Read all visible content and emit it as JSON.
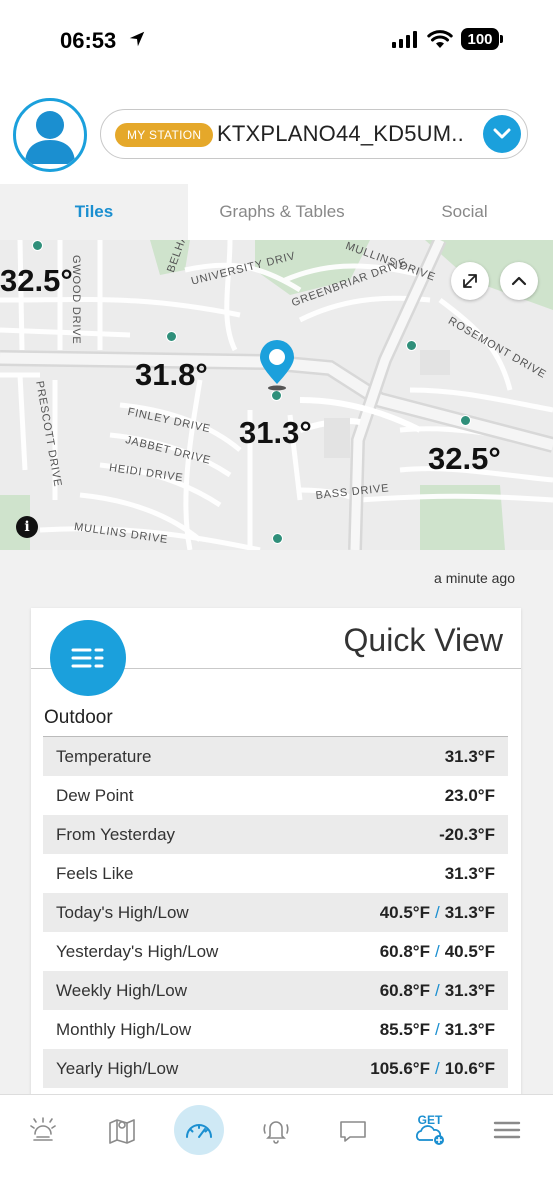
{
  "status_bar": {
    "time": "06:53",
    "battery": "100"
  },
  "header": {
    "station_badge": "MY STATION",
    "station_name": "KTXPLANO44_KD5UM.."
  },
  "tabs": [
    {
      "label": "Tiles",
      "active": true
    },
    {
      "label": "Graphs & Tables",
      "active": false
    },
    {
      "label": "Social",
      "active": false
    }
  ],
  "map": {
    "temps": [
      "32.5°",
      "31.8°",
      "31.3°",
      "32.5°"
    ],
    "streets": [
      "GWOOD DRIVE",
      "BELHA",
      "UNIVERSITY DRIV",
      "MULLINS DRIVE",
      "GREENBRIAR DRIVE",
      "ROSEMONT DRIVE",
      "PRESCOTT DRIVE",
      "FINLEY DRIVE",
      "JABBET DRIVE",
      "HEIDI DRIVE",
      "BASS DRIVE",
      "MULLINS DRIVE"
    ],
    "info_label": "i"
  },
  "updated": "a minute ago",
  "quick_view": {
    "title": "Quick View",
    "section": "Outdoor",
    "rows": [
      {
        "label": "Temperature",
        "value": "31.3°F"
      },
      {
        "label": "Dew Point",
        "value": "23.0°F"
      },
      {
        "label": "From Yesterday",
        "value": "-20.3°F"
      },
      {
        "label": "Feels Like",
        "value": "31.3°F"
      },
      {
        "label": "Today's High/Low",
        "high": "40.5°F",
        "sep": "/",
        "low": "31.3°F"
      },
      {
        "label": "Yesterday's High/Low",
        "high": "60.8°F",
        "sep": "/",
        "low": "40.5°F"
      },
      {
        "label": "Weekly High/Low",
        "high": "60.8°F",
        "sep": "/",
        "low": "31.3°F"
      },
      {
        "label": "Monthly High/Low",
        "high": "85.5°F",
        "sep": "/",
        "low": "31.3°F"
      },
      {
        "label": "Yearly High/Low",
        "high": "105.6°F",
        "sep": "/",
        "low": "10.6°F"
      }
    ]
  },
  "bottom_nav": {
    "items": [
      "sun-icon",
      "map-icon",
      "dashboard-icon",
      "bell-icon",
      "chat-icon",
      "get-app-icon",
      "menu-icon"
    ],
    "get_label": "GET"
  },
  "colors": {
    "accent": "#1ba0dc",
    "badge": "#e5a82a",
    "station_dot": "#2f8f7a"
  }
}
